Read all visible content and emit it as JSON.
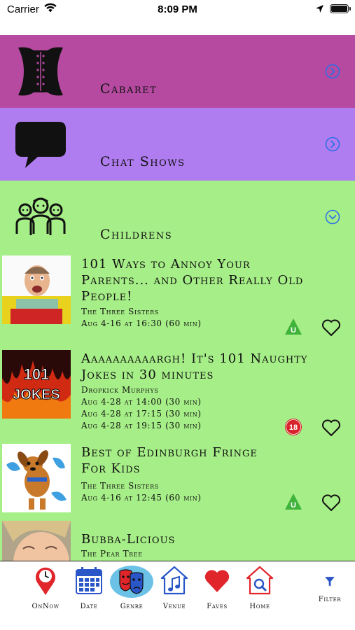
{
  "status_bar": {
    "carrier": "Carrier",
    "time": "8:09 PM"
  },
  "genres": [
    {
      "label": "Cabaret",
      "color": "#b54aa0",
      "icon": "corset-icon",
      "expanded": false
    },
    {
      "label": "Chat Shows",
      "color": "#b07df0",
      "icon": "speech-bubble-icon",
      "expanded": false
    },
    {
      "label": "Childrens",
      "color": "#a6ee87",
      "icon": "children-group-icon",
      "expanded": true
    }
  ],
  "shows": [
    {
      "title_lines": [
        "101 Ways to Annoy Your",
        "Parents... and Other Really Old",
        "People!"
      ],
      "venue": "The Three Sisters",
      "times": [
        "Aug 4-16 at 16:30 (60 min)"
      ],
      "rating": "U",
      "rating_color": "#3fb33a"
    },
    {
      "title_lines": [
        "Aaaaaaaaaargh! It's 101 Naughty",
        "Jokes in 30 minutes"
      ],
      "venue": "Dropkick Murphys",
      "times": [
        "Aug 4-28 at 14:00 (30 min)",
        "Aug 4-28 at 17:15 (30 min)",
        "Aug 4-28 at 19:15 (30 min)"
      ],
      "rating": "18",
      "rating_color": "#d8232a",
      "thumb_text": [
        "101",
        "JOKES"
      ]
    },
    {
      "title_lines": [
        "Best of Edinburgh Fringe",
        "For Kids"
      ],
      "venue": "The Three Sisters",
      "times": [
        "Aug 4-16 at 12:45 (60 min)"
      ],
      "rating": "U",
      "rating_color": "#3fb33a"
    },
    {
      "title_lines": [
        "Bubba-Licious"
      ],
      "venue": "The Pear Tree",
      "times": []
    }
  ],
  "tabs": [
    {
      "label": "OnNow",
      "icon": "clock-pin-icon"
    },
    {
      "label": "Date",
      "icon": "calendar-icon"
    },
    {
      "label": "Genre",
      "icon": "theatre-masks-icon",
      "active": true
    },
    {
      "label": "Venue",
      "icon": "music-house-icon"
    },
    {
      "label": "Faves",
      "icon": "heart-icon"
    },
    {
      "label": "Home",
      "icon": "home-search-icon"
    },
    {
      "label": "Filter",
      "icon": "filter-icon"
    }
  ]
}
